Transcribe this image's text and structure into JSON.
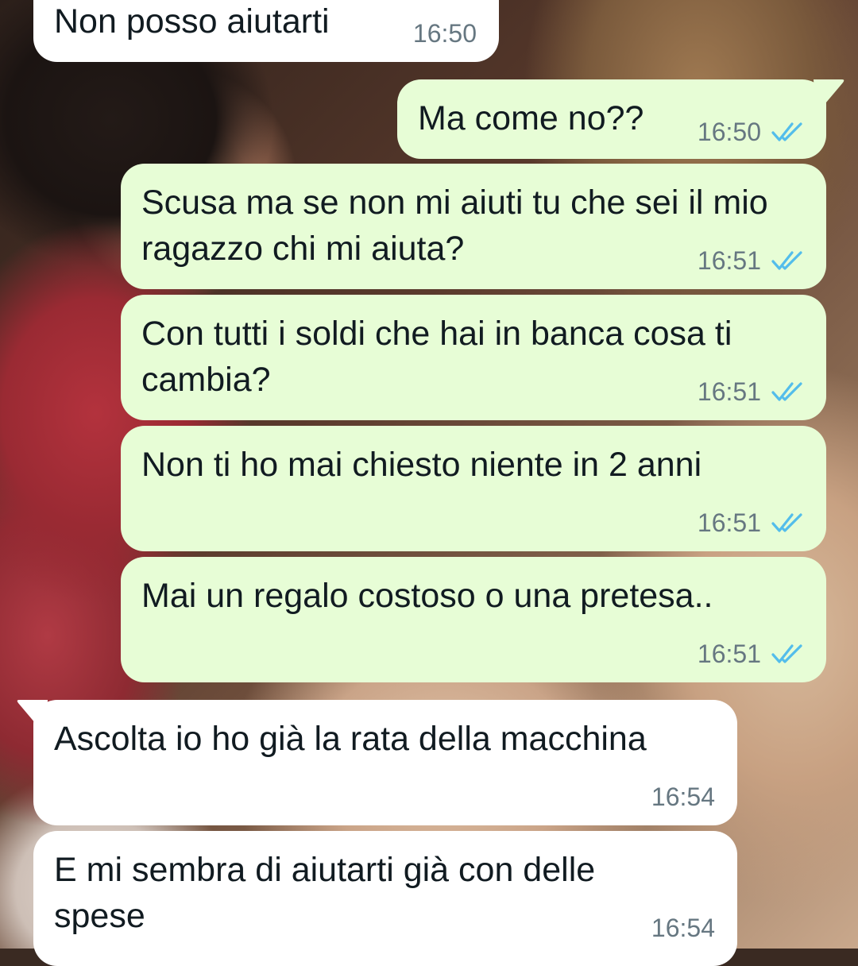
{
  "colors": {
    "incoming_bubble": "#ffffff",
    "outgoing_bubble": "#e7fdd6",
    "timestamp": "#667781",
    "read_ticks": "#53bdeb",
    "text": "#111b21"
  },
  "messages": [
    {
      "direction": "incoming",
      "text": "Non posso aiutarti",
      "time": "16:50",
      "status": ""
    },
    {
      "direction": "outgoing",
      "text": "Ma come no??",
      "time": "16:50",
      "status": "read"
    },
    {
      "direction": "outgoing",
      "text": "Scusa ma se non mi aiuti tu che sei il mio ragazzo chi mi aiuta?",
      "time": "16:51",
      "status": "read"
    },
    {
      "direction": "outgoing",
      "text": "Con tutti i soldi che hai in banca cosa ti cambia?",
      "time": "16:51",
      "status": "read"
    },
    {
      "direction": "outgoing",
      "text": "Non ti ho mai chiesto niente in 2 anni",
      "time": "16:51",
      "status": "read"
    },
    {
      "direction": "outgoing",
      "text": "Mai un regalo costoso o una pretesa..",
      "time": "16:51",
      "status": "read"
    },
    {
      "direction": "incoming",
      "text": "Ascolta io ho già la rata della macchina",
      "time": "16:54",
      "status": ""
    },
    {
      "direction": "incoming",
      "text": "E mi sembra di aiutarti già con delle spese",
      "time": "16:54",
      "status": ""
    }
  ],
  "icons": {
    "read_receipt": "double-check-icon"
  }
}
